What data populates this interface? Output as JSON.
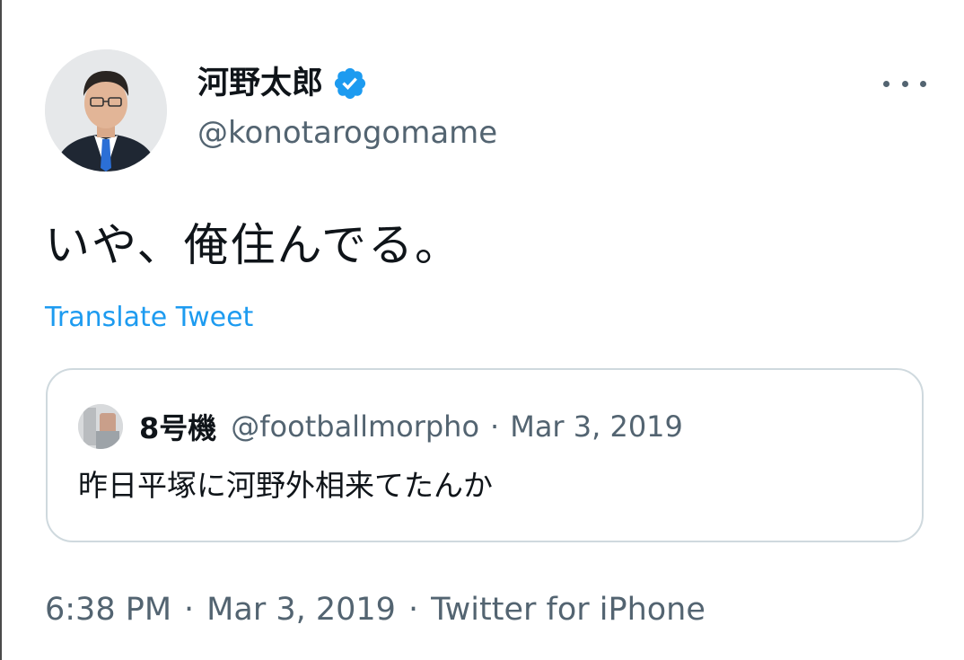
{
  "tweet": {
    "author": {
      "display_name": "河野太郎",
      "handle": "@konotarogomame",
      "verified": true,
      "avatar_icon": "profile-photo"
    },
    "text": "いや、俺住んでる。",
    "translate_label": "Translate Tweet",
    "more_icon": "ellipsis-icon",
    "quoted": {
      "author_name": "8号機",
      "author_handle": "@footballmorpho",
      "separator": "·",
      "date": "Mar 3, 2019",
      "text": "昨日平塚に河野外相来てたんか"
    },
    "meta": {
      "time": "6:38 PM",
      "separator": "·",
      "date": "Mar 3, 2019",
      "source": "Twitter for iPhone"
    }
  },
  "colors": {
    "text_primary": "#0f1419",
    "text_secondary": "#536471",
    "accent": "#1d9bf0",
    "border": "#cfd9de"
  }
}
